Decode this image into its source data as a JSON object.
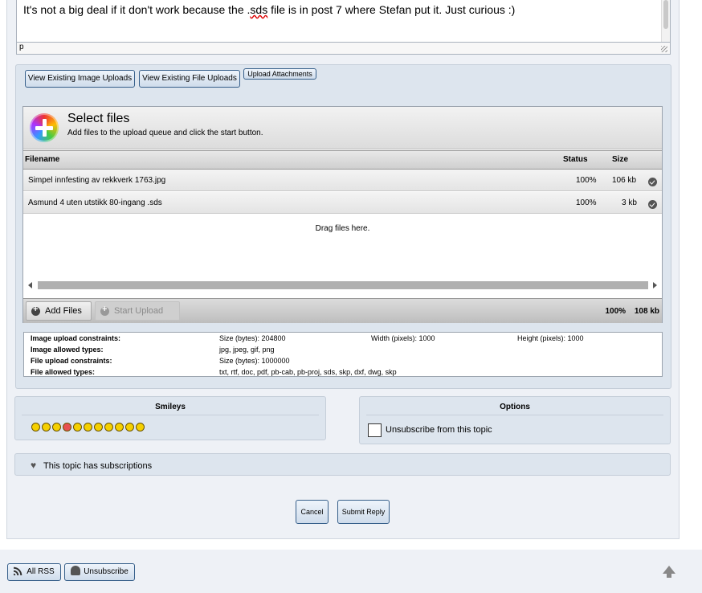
{
  "editor": {
    "text_before": "It's not a big deal if it don't work because the .",
    "text_misspelled": "sds",
    "text_after": " file is in post 7 where Stefan put it. Just curious :)",
    "status_path": "p"
  },
  "upload_buttons": {
    "view_images": "View Existing Image Uploads",
    "view_files": "View Existing File Uploads",
    "upload_attachments": "Upload Attachments"
  },
  "uploader": {
    "title": "Select files",
    "subtitle": "Add files to the upload queue and click the start button.",
    "columns": {
      "filename": "Filename",
      "status": "Status",
      "size": "Size"
    },
    "files": [
      {
        "name": "Simpel innfesting av rekkverk 1763.jpg",
        "status": "100%",
        "size": "106 kb"
      },
      {
        "name": "Asmund 4 uten utstikk 80-ingang .sds",
        "status": "100%",
        "size": "3 kb"
      }
    ],
    "drag_text": "Drag files here.",
    "add_files": "Add Files",
    "start_upload": "Start Upload",
    "total_status": "100%",
    "total_size": "108 kb"
  },
  "constraints": {
    "image_upload_label": "Image upload constraints:",
    "image_size": "Size (bytes):  204800",
    "image_width": "Width (pixels):  1000",
    "image_height": "Height (pixels):  1000",
    "image_types_label": "Image allowed types:",
    "image_types": "jpg, jpeg, gif, png",
    "file_upload_label": "File upload constraints:",
    "file_size": "Size (bytes):  1000000",
    "file_types_label": "File allowed types:",
    "file_types": "txt, rtf, doc, pdf, pb-cab, pb-proj, sds, skp, dxf, dwg, skp"
  },
  "smileys": {
    "title": "Smileys"
  },
  "options": {
    "title": "Options",
    "unsubscribe_label": "Unsubscribe from this topic"
  },
  "subscriptions": {
    "text": "This topic has subscriptions"
  },
  "form": {
    "cancel": "Cancel",
    "submit": "Submit Reply"
  },
  "footer": {
    "rss": "All RSS",
    "unsubscribe": "Unsubscribe"
  },
  "colors": {
    "button_border": "#365f8a",
    "panel_bg": "#dde5ee",
    "smiley": "#f5d000"
  }
}
